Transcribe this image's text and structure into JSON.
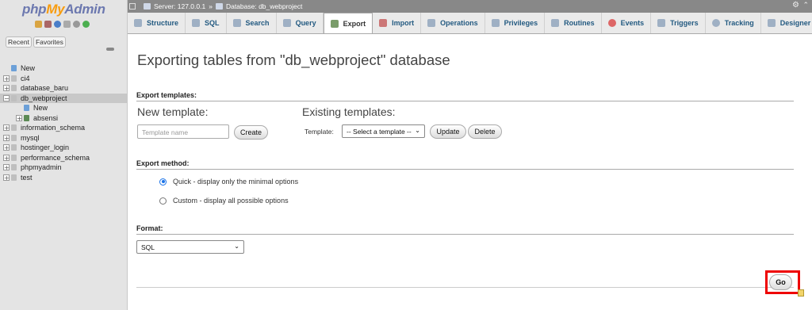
{
  "sidebar": {
    "logo": {
      "php": "php",
      "my": "My",
      "admin": "Admin"
    },
    "header_icons": [
      "home-icon",
      "database-icon",
      "help-icon",
      "docs-icon",
      "settings-icon",
      "reload-icon"
    ],
    "tabs": [
      "Recent",
      "Favorites"
    ],
    "tree": [
      {
        "label": "New",
        "type": "new",
        "indent": 0,
        "expander": ""
      },
      {
        "label": "ci4",
        "type": "db",
        "indent": 0,
        "expander": "+"
      },
      {
        "label": "database_baru",
        "type": "db",
        "indent": 0,
        "expander": "+"
      },
      {
        "label": "db_webproject",
        "type": "db",
        "indent": 0,
        "expander": "−",
        "selected": true
      },
      {
        "label": "New",
        "type": "new",
        "indent": 1,
        "expander": ""
      },
      {
        "label": "absensi",
        "type": "tbl",
        "indent": 1,
        "expander": "+"
      },
      {
        "label": "information_schema",
        "type": "db",
        "indent": 0,
        "expander": "+"
      },
      {
        "label": "mysql",
        "type": "db",
        "indent": 0,
        "expander": "+"
      },
      {
        "label": "hostinger_login",
        "type": "db",
        "indent": 0,
        "expander": "+"
      },
      {
        "label": "performance_schema",
        "type": "db",
        "indent": 0,
        "expander": "+"
      },
      {
        "label": "phpmyadmin",
        "type": "db",
        "indent": 0,
        "expander": "+"
      },
      {
        "label": "test",
        "type": "db",
        "indent": 0,
        "expander": "+"
      }
    ]
  },
  "breadcrumb": {
    "server": "Server: 127.0.0.1",
    "sep": "»",
    "database": "Database: db_webproject"
  },
  "tabs": [
    {
      "label": "Structure",
      "icon": "structure-icon"
    },
    {
      "label": "SQL",
      "icon": "sql-icon"
    },
    {
      "label": "Search",
      "icon": "search-icon"
    },
    {
      "label": "Query",
      "icon": "query-icon"
    },
    {
      "label": "Export",
      "icon": "export-icon",
      "active": true
    },
    {
      "label": "Import",
      "icon": "import-icon"
    },
    {
      "label": "Operations",
      "icon": "operations-icon"
    },
    {
      "label": "Privileges",
      "icon": "privileges-icon"
    },
    {
      "label": "Routines",
      "icon": "routines-icon"
    },
    {
      "label": "Events",
      "icon": "events-icon"
    },
    {
      "label": "Triggers",
      "icon": "triggers-icon"
    },
    {
      "label": "Tracking",
      "icon": "tracking-icon"
    },
    {
      "label": "Designer",
      "icon": "designer-icon"
    }
  ],
  "page": {
    "title": "Exporting tables from \"db_webproject\" database",
    "export_templates": {
      "heading": "Export templates:",
      "new_template": "New template:",
      "template_name_placeholder": "Template name",
      "create_label": "Create",
      "existing_templates": "Existing templates:",
      "template_label": "Template:",
      "select_value": "-- Select a template --",
      "update_label": "Update",
      "delete_label": "Delete"
    },
    "export_method": {
      "heading": "Export method:",
      "quick": "Quick - display only the minimal options",
      "custom": "Custom - display all possible options",
      "selected": "quick"
    },
    "format": {
      "heading": "Format:",
      "value": "SQL"
    },
    "go_label": "Go"
  }
}
